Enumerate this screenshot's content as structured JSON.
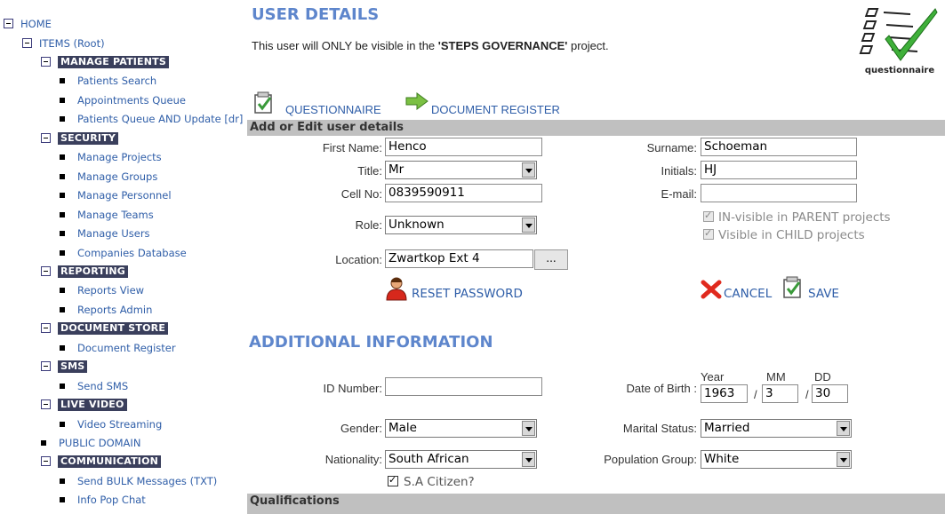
{
  "sidebar": {
    "home": "HOME",
    "items_root": "ITEMS (Root)",
    "groups": [
      {
        "title": "MANAGE PATIENTS",
        "items": [
          "Patients Search",
          "Appointments Queue",
          "Patients Queue AND Update [dr]"
        ]
      },
      {
        "title": "SECURITY",
        "items": [
          "Manage Projects",
          "Manage Groups",
          "Manage Personnel",
          "Manage Teams",
          "Manage Users",
          "Companies Database"
        ]
      },
      {
        "title": "REPORTING",
        "items": [
          "Reports View",
          "Reports Admin"
        ]
      },
      {
        "title": "DOCUMENT STORE",
        "items": [
          "Document Register"
        ]
      },
      {
        "title": "SMS",
        "items": [
          "Send SMS"
        ]
      },
      {
        "title": "LIVE VIDEO",
        "items": [
          "Video Streaming"
        ]
      }
    ],
    "public_domain": "PUBLIC DOMAIN",
    "communication": {
      "title": "COMMUNICATION",
      "items": [
        "Send BULK Messages (TXT)",
        "Info Pop Chat"
      ]
    }
  },
  "page": {
    "title": "USER DETAILS",
    "intro_prefix": "This user will ONLY be visible in the ",
    "intro_project": "'STEPS GOVERNANCE'",
    "intro_suffix": " project.",
    "badge_label": "questionnaire"
  },
  "nav": {
    "questionnaire": "QUESTIONNAIRE",
    "document_register": "DOCUMENT REGISTER"
  },
  "user_form": {
    "header": "Add or Edit user details",
    "first_name_label": "First Name:",
    "first_name": "Henco",
    "surname_label": "Surname:",
    "surname": "Schoeman",
    "title_label": "Title:",
    "title_value": "Mr",
    "initials_label": "Initials:",
    "initials": "HJ",
    "cell_label": "Cell No:",
    "cell": "0839590911",
    "email_label": "E-mail:",
    "email": "",
    "role_label": "Role:",
    "role_value": "Unknown",
    "invisible_parent": "IN-visible in PARENT projects",
    "visible_child": "Visible in CHILD projects",
    "location_label": "Location:",
    "location": "Zwartkop Ext 4",
    "location_button": "...",
    "reset_password": "RESET PASSWORD",
    "cancel": "CANCEL",
    "save": "SAVE"
  },
  "additional": {
    "header": "ADDITIONAL INFORMATION",
    "id_label": "ID Number:",
    "id_value": "",
    "dob_label": "Date of Birth :",
    "year_label": "Year",
    "mm_label": "MM",
    "dd_label": "DD",
    "year": "1963",
    "month": "3",
    "day": "30",
    "sep": "/",
    "gender_label": "Gender:",
    "gender": "Male",
    "marital_label": "Marital Status:",
    "marital": "Married",
    "nationality_label": "Nationality:",
    "nationality": "South African",
    "population_label": "Population Group:",
    "population": "White",
    "sa_citizen": "S.A Citizen?"
  },
  "qualifications": {
    "header": "Qualifications"
  },
  "colors": {
    "accent": "#5e86cc",
    "link": "#2f5ea8",
    "tree_header_bg": "#3a3f5c",
    "bar_bg": "#c0c0c0"
  }
}
